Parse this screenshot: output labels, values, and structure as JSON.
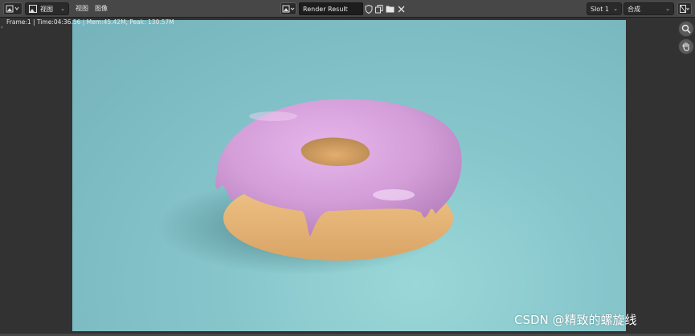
{
  "header": {
    "editor_type_icon": "image-editor-icon",
    "view_mode": "视图",
    "menus": [
      "视图",
      "图像"
    ],
    "image_name": "Render Result",
    "slot": "Slot 1",
    "layer": "合成"
  },
  "status_text": "Frame:1 | Time:04:36.56 | Mem:45.42M, Peak: 130.57M",
  "nav_icons": [
    "zoom-icon",
    "pan-hand-icon"
  ],
  "watermark": "CSDN @精致的螺旋线",
  "colors": {
    "header_bg": "#474747",
    "viewport_bg": "#323232",
    "render_bg": "#86c6cb",
    "icing": "#d7a2dc",
    "dough": "#e8b979"
  }
}
